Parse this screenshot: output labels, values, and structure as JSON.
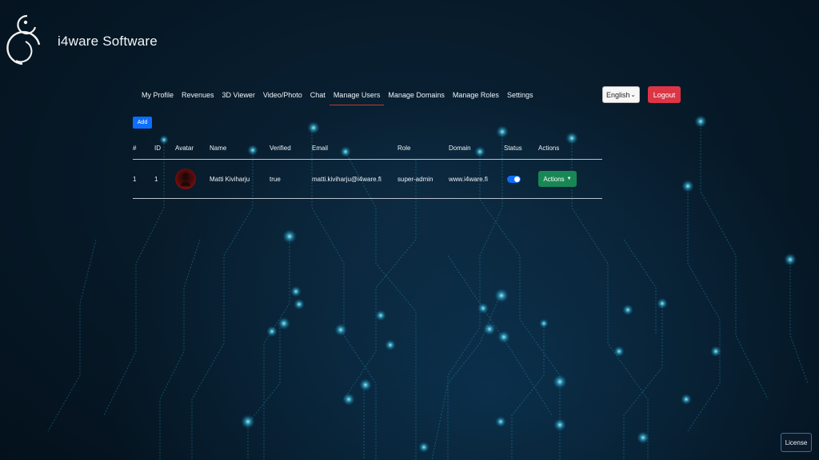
{
  "brand": {
    "name": "i4ware Software"
  },
  "nav": {
    "items": [
      "My Profile",
      "Revenues",
      "3D Viewer",
      "Video/Photo",
      "Chat",
      "Manage Users",
      "Manage Domains",
      "Manage Roles",
      "Settings"
    ],
    "active": "Manage Users"
  },
  "language": {
    "selected": "English"
  },
  "logout_label": "Logout",
  "add_label": "Add",
  "table": {
    "headers": [
      "#",
      "ID",
      "Avatar",
      "Name",
      "Verified",
      "Email",
      "Role",
      "Domain",
      "Status",
      "Actions"
    ],
    "rows": [
      {
        "index": "1",
        "id": "1",
        "name": "Matti Kiviharju",
        "verified": "true",
        "email": "matti.kiviharju@i4ware.fi",
        "role": "super-admin",
        "domain": "www.i4ware.fi",
        "status_on": true,
        "actions_label": "Actions"
      }
    ]
  },
  "license_label": "License",
  "colors": {
    "accent": "#0d6efd",
    "danger": "#dc3545",
    "success": "#198754",
    "background": "#061826"
  }
}
